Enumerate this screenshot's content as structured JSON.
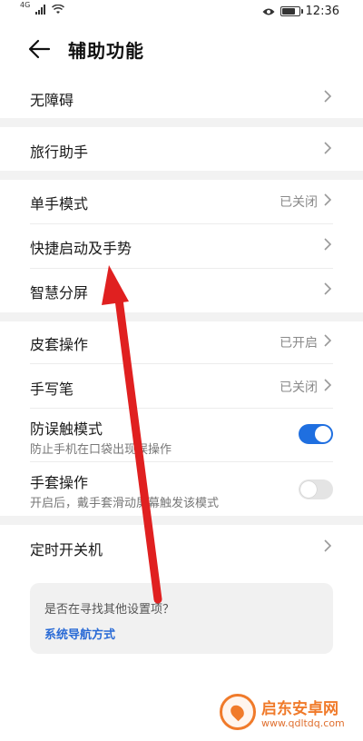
{
  "status_bar": {
    "network_label": "4G",
    "time": "12:36",
    "battery_level": 0.85,
    "icons": [
      "signal-icon",
      "wifi-icon",
      "eye-icon",
      "battery-icon"
    ]
  },
  "header": {
    "title": "辅助功能",
    "back_icon": "back-arrow-icon"
  },
  "sections": [
    {
      "items": [
        {
          "label": "无障碍"
        }
      ]
    },
    {
      "items": [
        {
          "label": "旅行助手"
        }
      ]
    },
    {
      "items": [
        {
          "label": "单手模式",
          "value": "已关闭"
        },
        {
          "label": "快捷启动及手势"
        },
        {
          "label": "智慧分屏"
        }
      ]
    },
    {
      "items": [
        {
          "label": "皮套操作",
          "value": "已开启"
        },
        {
          "label": "手写笔",
          "value": "已关闭"
        },
        {
          "label": "防误触模式",
          "sub": "防止手机在口袋出现误操作",
          "toggle": true
        },
        {
          "label": "手套操作",
          "sub": "开启后，戴手套滑动屏幕触发该模式",
          "toggle": false
        }
      ]
    },
    {
      "items": [
        {
          "label": "定时开关机"
        }
      ]
    }
  ],
  "suggest": {
    "question": "是否在寻找其他设置项？",
    "link": "系统导航方式"
  },
  "watermark": {
    "title": "启东安卓网",
    "url": "www.qdltdq.com"
  },
  "colors": {
    "accent": "#1f6fe0",
    "link": "#2a6bd6",
    "annotation_arrow": "#e02020",
    "watermark": "#f07a2a"
  }
}
